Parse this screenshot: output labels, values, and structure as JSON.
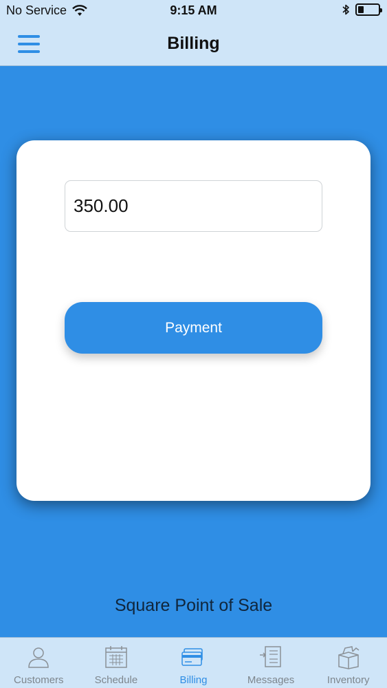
{
  "status": {
    "carrier": "No Service",
    "time": "9:15 AM",
    "battery_level": 0.3
  },
  "header": {
    "title": "Billing",
    "menu_icon": "hamburger-icon",
    "accent_color": "#2f8ee5"
  },
  "billing": {
    "amount": "350.00",
    "payment_label": "Payment"
  },
  "footer": {
    "link_text": "Square Point of Sale"
  },
  "tabs": [
    {
      "label": "Customers",
      "icon": "person-icon",
      "active": false
    },
    {
      "label": "Schedule",
      "icon": "calendar-icon",
      "active": false
    },
    {
      "label": "Billing",
      "icon": "credit-card-icon",
      "active": true
    },
    {
      "label": "Messages",
      "icon": "messages-icon",
      "active": false
    },
    {
      "label": "Inventory",
      "icon": "box-icon",
      "active": false
    }
  ]
}
